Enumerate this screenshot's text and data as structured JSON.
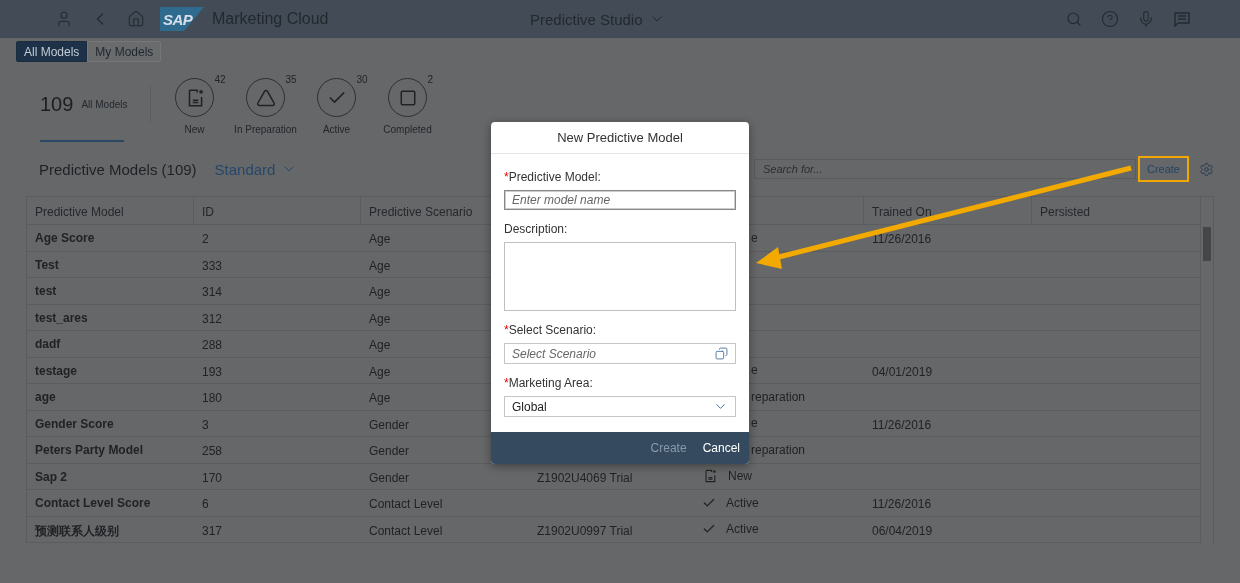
{
  "shell": {
    "logo": "SAP",
    "title": "Marketing Cloud",
    "app_title": "Predictive Studio"
  },
  "view_toggle": [
    {
      "label": "All Models",
      "selected": true
    },
    {
      "label": "My Models",
      "selected": false
    }
  ],
  "kpi": {
    "count": "109",
    "label": "All Models"
  },
  "status_filters": [
    {
      "kind": "new",
      "label": "New",
      "count": "42"
    },
    {
      "kind": "preparation",
      "label": "In Preparation",
      "count": "35"
    },
    {
      "kind": "active",
      "label": "Active",
      "count": "30"
    },
    {
      "kind": "completed",
      "label": "Completed",
      "count": "2"
    }
  ],
  "table_title": "Predictive Models (109)",
  "variant": "Standard",
  "search": {
    "placeholder": "Search for..."
  },
  "create_button": "Create",
  "table": {
    "columns": [
      "Predictive Model",
      "ID",
      "Predictive Scenario",
      "Trained On",
      "Persisted"
    ],
    "rows": [
      {
        "model": "Age Score",
        "id": "2",
        "scenario": "Age",
        "status": {
          "kind": "partial",
          "text": "e"
        },
        "trained_on": "11/26/2016"
      },
      {
        "model": "Test",
        "id": "333",
        "scenario": "Age"
      },
      {
        "model": "test",
        "id": "314",
        "scenario": "Age"
      },
      {
        "model": "test_ares",
        "id": "312",
        "scenario": "Age"
      },
      {
        "model": "dadf",
        "id": "288",
        "scenario": "Age"
      },
      {
        "model": "testage",
        "id": "193",
        "scenario": "Age",
        "status": {
          "kind": "partial",
          "text": "e"
        },
        "trained_on": "04/01/2019"
      },
      {
        "model": "age",
        "id": "180",
        "scenario": "Age",
        "status": {
          "kind": "partial",
          "text": "reparation"
        }
      },
      {
        "model": "Gender Score",
        "id": "3",
        "scenario": "Gender",
        "status": {
          "kind": "partial",
          "text": "e"
        },
        "trained_on": "11/26/2016"
      },
      {
        "model": "Peters Party Model",
        "id": "258",
        "scenario": "Gender",
        "status": {
          "kind": "partial",
          "text": "reparation"
        }
      },
      {
        "model": "Sap 2",
        "id": "170",
        "scenario": "Gender",
        "column_4": "Z1902U4069 Trial",
        "status": {
          "kind": "new",
          "text": "New"
        }
      },
      {
        "model": "Contact Level Score",
        "id": "6",
        "scenario": "Contact Level",
        "status": {
          "kind": "active",
          "text": "Active"
        },
        "trained_on": "11/26/2016"
      },
      {
        "model": "预测联系人级别",
        "id": "317",
        "scenario": "Contact Level",
        "column_4": "Z1902U0997 Trial",
        "status": {
          "kind": "active",
          "text": "Active"
        },
        "trained_on": "06/04/2019"
      }
    ]
  },
  "dialog": {
    "title": "New Predictive Model",
    "fields": [
      {
        "kind": "input",
        "required_mark": "*",
        "label": "Predictive Model:",
        "placeholder": "Enter model name"
      },
      {
        "kind": "textarea",
        "label": "Description:"
      },
      {
        "kind": "value-help",
        "required_mark": "*",
        "label": "Select Scenario:",
        "placeholder": "Select Scenario"
      },
      {
        "kind": "select",
        "required_mark": "*",
        "label": "Marketing Area:",
        "value": "Global"
      }
    ],
    "buttons": [
      {
        "label": "Create",
        "disabled": true
      },
      {
        "label": "Cancel",
        "disabled": false
      }
    ]
  }
}
